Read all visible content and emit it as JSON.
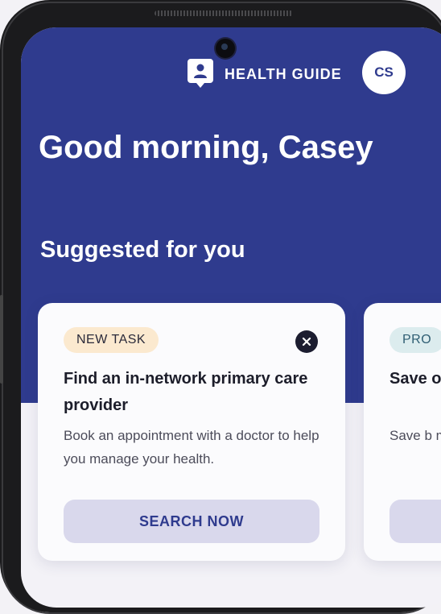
{
  "header": {
    "guide_label": "HEALTH GUIDE",
    "avatar_initials": "CS"
  },
  "greeting": "Good morning, Casey",
  "section_title": "Suggested for you",
  "cards": [
    {
      "badge": "NEW TASK",
      "title": "Find an in-network primary care provider",
      "description": "Book an appointment with a doctor to help you manage your health.",
      "cta": "SEARCH NOW"
    },
    {
      "badge": "PRO",
      "title": "Save on Le",
      "description": "Save b medic",
      "cta": ""
    }
  ],
  "colors": {
    "brand": "#2f3b8e",
    "badge_task": "#fbe9cf",
    "badge_promo": "#dcecee",
    "cta_bg": "#d9d8ec"
  },
  "icons": {
    "guide": "chat-person-icon",
    "close": "close-icon"
  }
}
